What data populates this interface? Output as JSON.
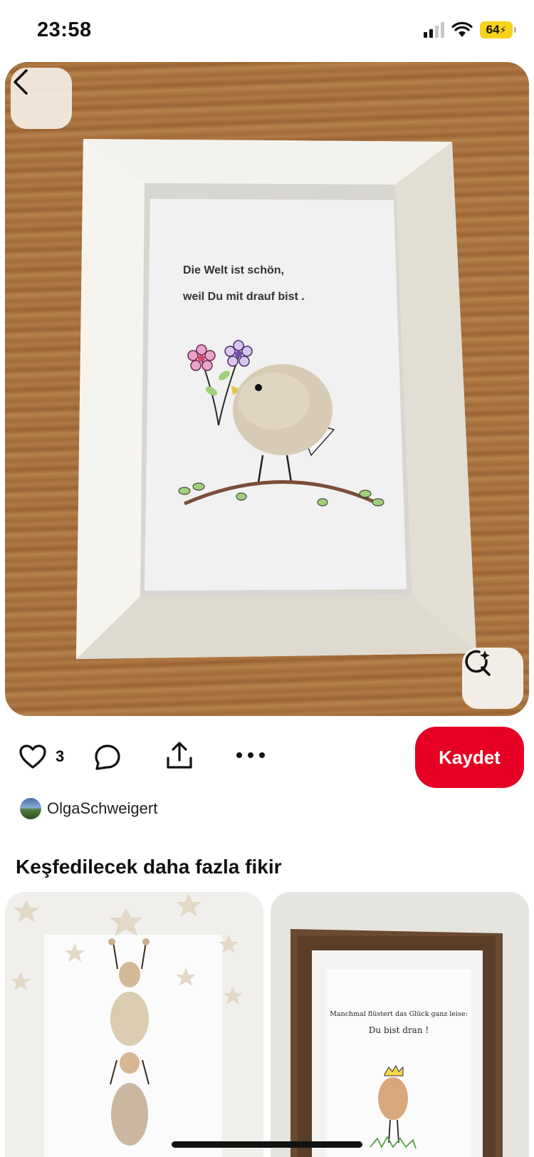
{
  "status_bar": {
    "time": "23:58",
    "battery": "64"
  },
  "pin": {
    "image_text_line1": "Die Welt ist schön,",
    "image_text_line2": "weil Du mit drauf bist .",
    "like_count": "3",
    "save_label": "Kaydet",
    "author_name": "OlgaSchweigert"
  },
  "more_ideas": {
    "title": "Keşfedilecek daha fazla fikir",
    "cards": [
      {
        "image_text_line1": "",
        "image_text_line2": ""
      },
      {
        "image_text_line1": "Manchmal flüstert das Glück ganz leise:",
        "image_text_line2": "Du bist dran !"
      }
    ]
  },
  "colors": {
    "save_button": "#e60023",
    "battery": "#f6d21b"
  }
}
